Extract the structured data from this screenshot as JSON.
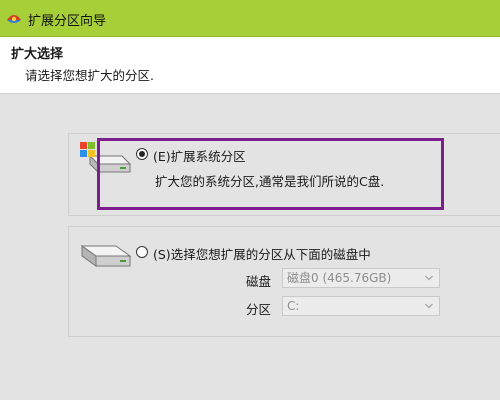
{
  "window": {
    "title": "扩展分区向导"
  },
  "header": {
    "title": "扩大选择",
    "subtitle": "请选择您想扩大的分区."
  },
  "options": [
    {
      "label": "(E)扩展系统分区",
      "description": "扩大您的系统分区,通常是我们所说的C盘.",
      "selected": true
    },
    {
      "label": "(S)选择您想扩展的分区从下面的磁盘中",
      "selected": false
    }
  ],
  "fields": {
    "disk_label": "磁盘",
    "disk_value": "磁盘0 (465.76GB)",
    "partition_label": "分区",
    "partition_value": "C:"
  },
  "icons": {
    "app": "partition-wizard-icon",
    "system_drive": "windows-drive-icon",
    "disk_drive": "hard-drive-icon",
    "dropdown": "chevron-down-icon"
  },
  "colors": {
    "titlebar": "#a6cf38",
    "highlight_border": "#7c1f8d",
    "background": "#e3e3e3"
  }
}
